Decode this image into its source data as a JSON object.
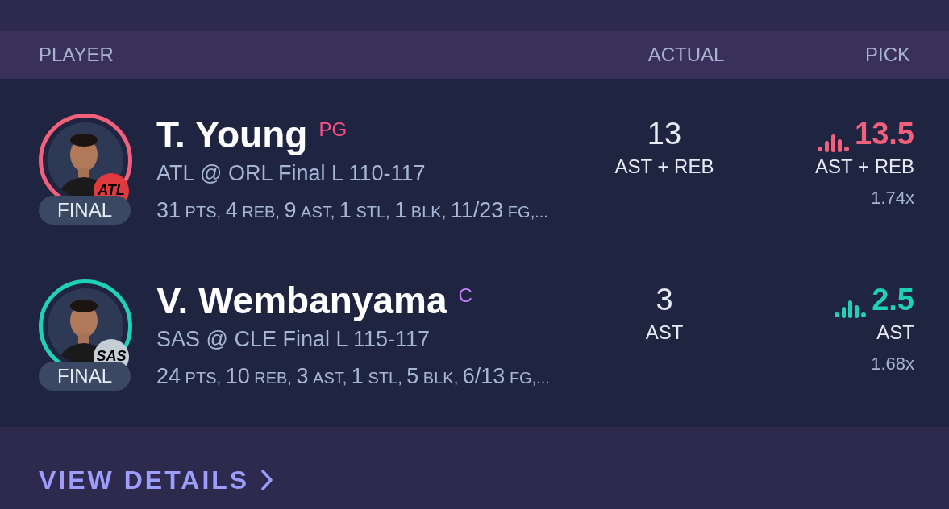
{
  "columns": [
    "PLAYER",
    "ACTUAL",
    "PICK"
  ],
  "players": [
    {
      "name": "T. Young",
      "position": {
        "label": "PG",
        "color": "#ff4f8b"
      },
      "color": "#f2607c",
      "team": {
        "label": "ATL",
        "color": "#e03a3e"
      },
      "status": "FINAL",
      "game": "ATL @ ORL Final L 110-117",
      "stats": [
        {
          "value": "31",
          "unit": "PTS,"
        },
        {
          "value": "4",
          "unit": "REB,"
        },
        {
          "value": "9",
          "unit": "AST,"
        },
        {
          "value": "1",
          "unit": "STL,"
        },
        {
          "value": "1",
          "unit": "BLK,"
        },
        {
          "value": "11/23",
          "unit": "FG,..."
        }
      ],
      "actual": "13",
      "actual_label": "AST + REB",
      "pick": "13.5",
      "pick_label": "AST + REB",
      "multiplier": "1.74x"
    },
    {
      "name": "V. Wembanyama",
      "position": {
        "label": "C",
        "color": "#c77dff"
      },
      "color": "#1fd1b8",
      "team": {
        "label": "SAS",
        "color": "#c4ced4"
      },
      "status": "FINAL",
      "game": "SAS @ CLE Final L 115-117",
      "stats": [
        {
          "value": "24",
          "unit": "PTS,"
        },
        {
          "value": "10",
          "unit": "REB,"
        },
        {
          "value": "3",
          "unit": "AST,"
        },
        {
          "value": "1",
          "unit": "STL,"
        },
        {
          "value": "5",
          "unit": "BLK,"
        },
        {
          "value": "6/13",
          "unit": "FG,..."
        }
      ],
      "actual": "3",
      "actual_label": "AST",
      "pick": "2.5",
      "pick_label": "AST",
      "multiplier": "1.68x"
    }
  ],
  "link": "VIEW DETAILS"
}
